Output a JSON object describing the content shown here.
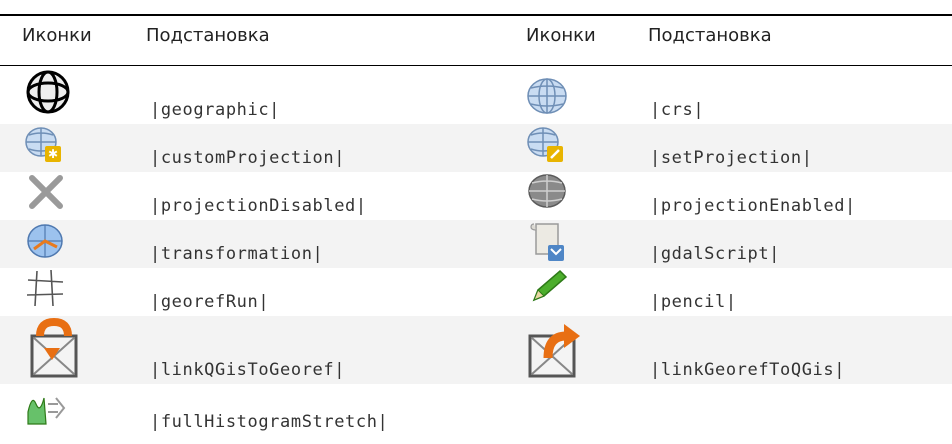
{
  "headers": {
    "icons_1": "Иконки",
    "subst_1": "Подстановка",
    "icons_2": "Иконки",
    "subst_2": "Подстановка"
  },
  "rows": [
    {
      "left": {
        "icon": "geographic-icon",
        "code": "|geographic|"
      },
      "right": {
        "icon": "crs-icon",
        "code": "|crs|"
      }
    },
    {
      "left": {
        "icon": "custom-projection-icon",
        "code": "|customProjection|"
      },
      "right": {
        "icon": "set-projection-icon",
        "code": "|setProjection|"
      }
    },
    {
      "left": {
        "icon": "projection-disabled-icon",
        "code": "|projectionDisabled|"
      },
      "right": {
        "icon": "projection-enabled-icon",
        "code": "|projectionEnabled|"
      }
    },
    {
      "left": {
        "icon": "transformation-icon",
        "code": "|transformation|"
      },
      "right": {
        "icon": "gdal-script-icon",
        "code": "|gdalScript|"
      }
    },
    {
      "left": {
        "icon": "georef-run-icon",
        "code": "|georefRun|"
      },
      "right": {
        "icon": "pencil-icon",
        "code": "|pencil|"
      }
    },
    {
      "left": {
        "icon": "link-qgis-to-georef-icon",
        "code": "|linkQGisToGeoref|"
      },
      "right": {
        "icon": "link-georef-to-qgis-icon",
        "code": "|linkGeorefToQGis|"
      }
    },
    {
      "left": {
        "icon": "full-histogram-stretch-icon",
        "code": "|fullHistogramStretch|"
      }
    }
  ]
}
